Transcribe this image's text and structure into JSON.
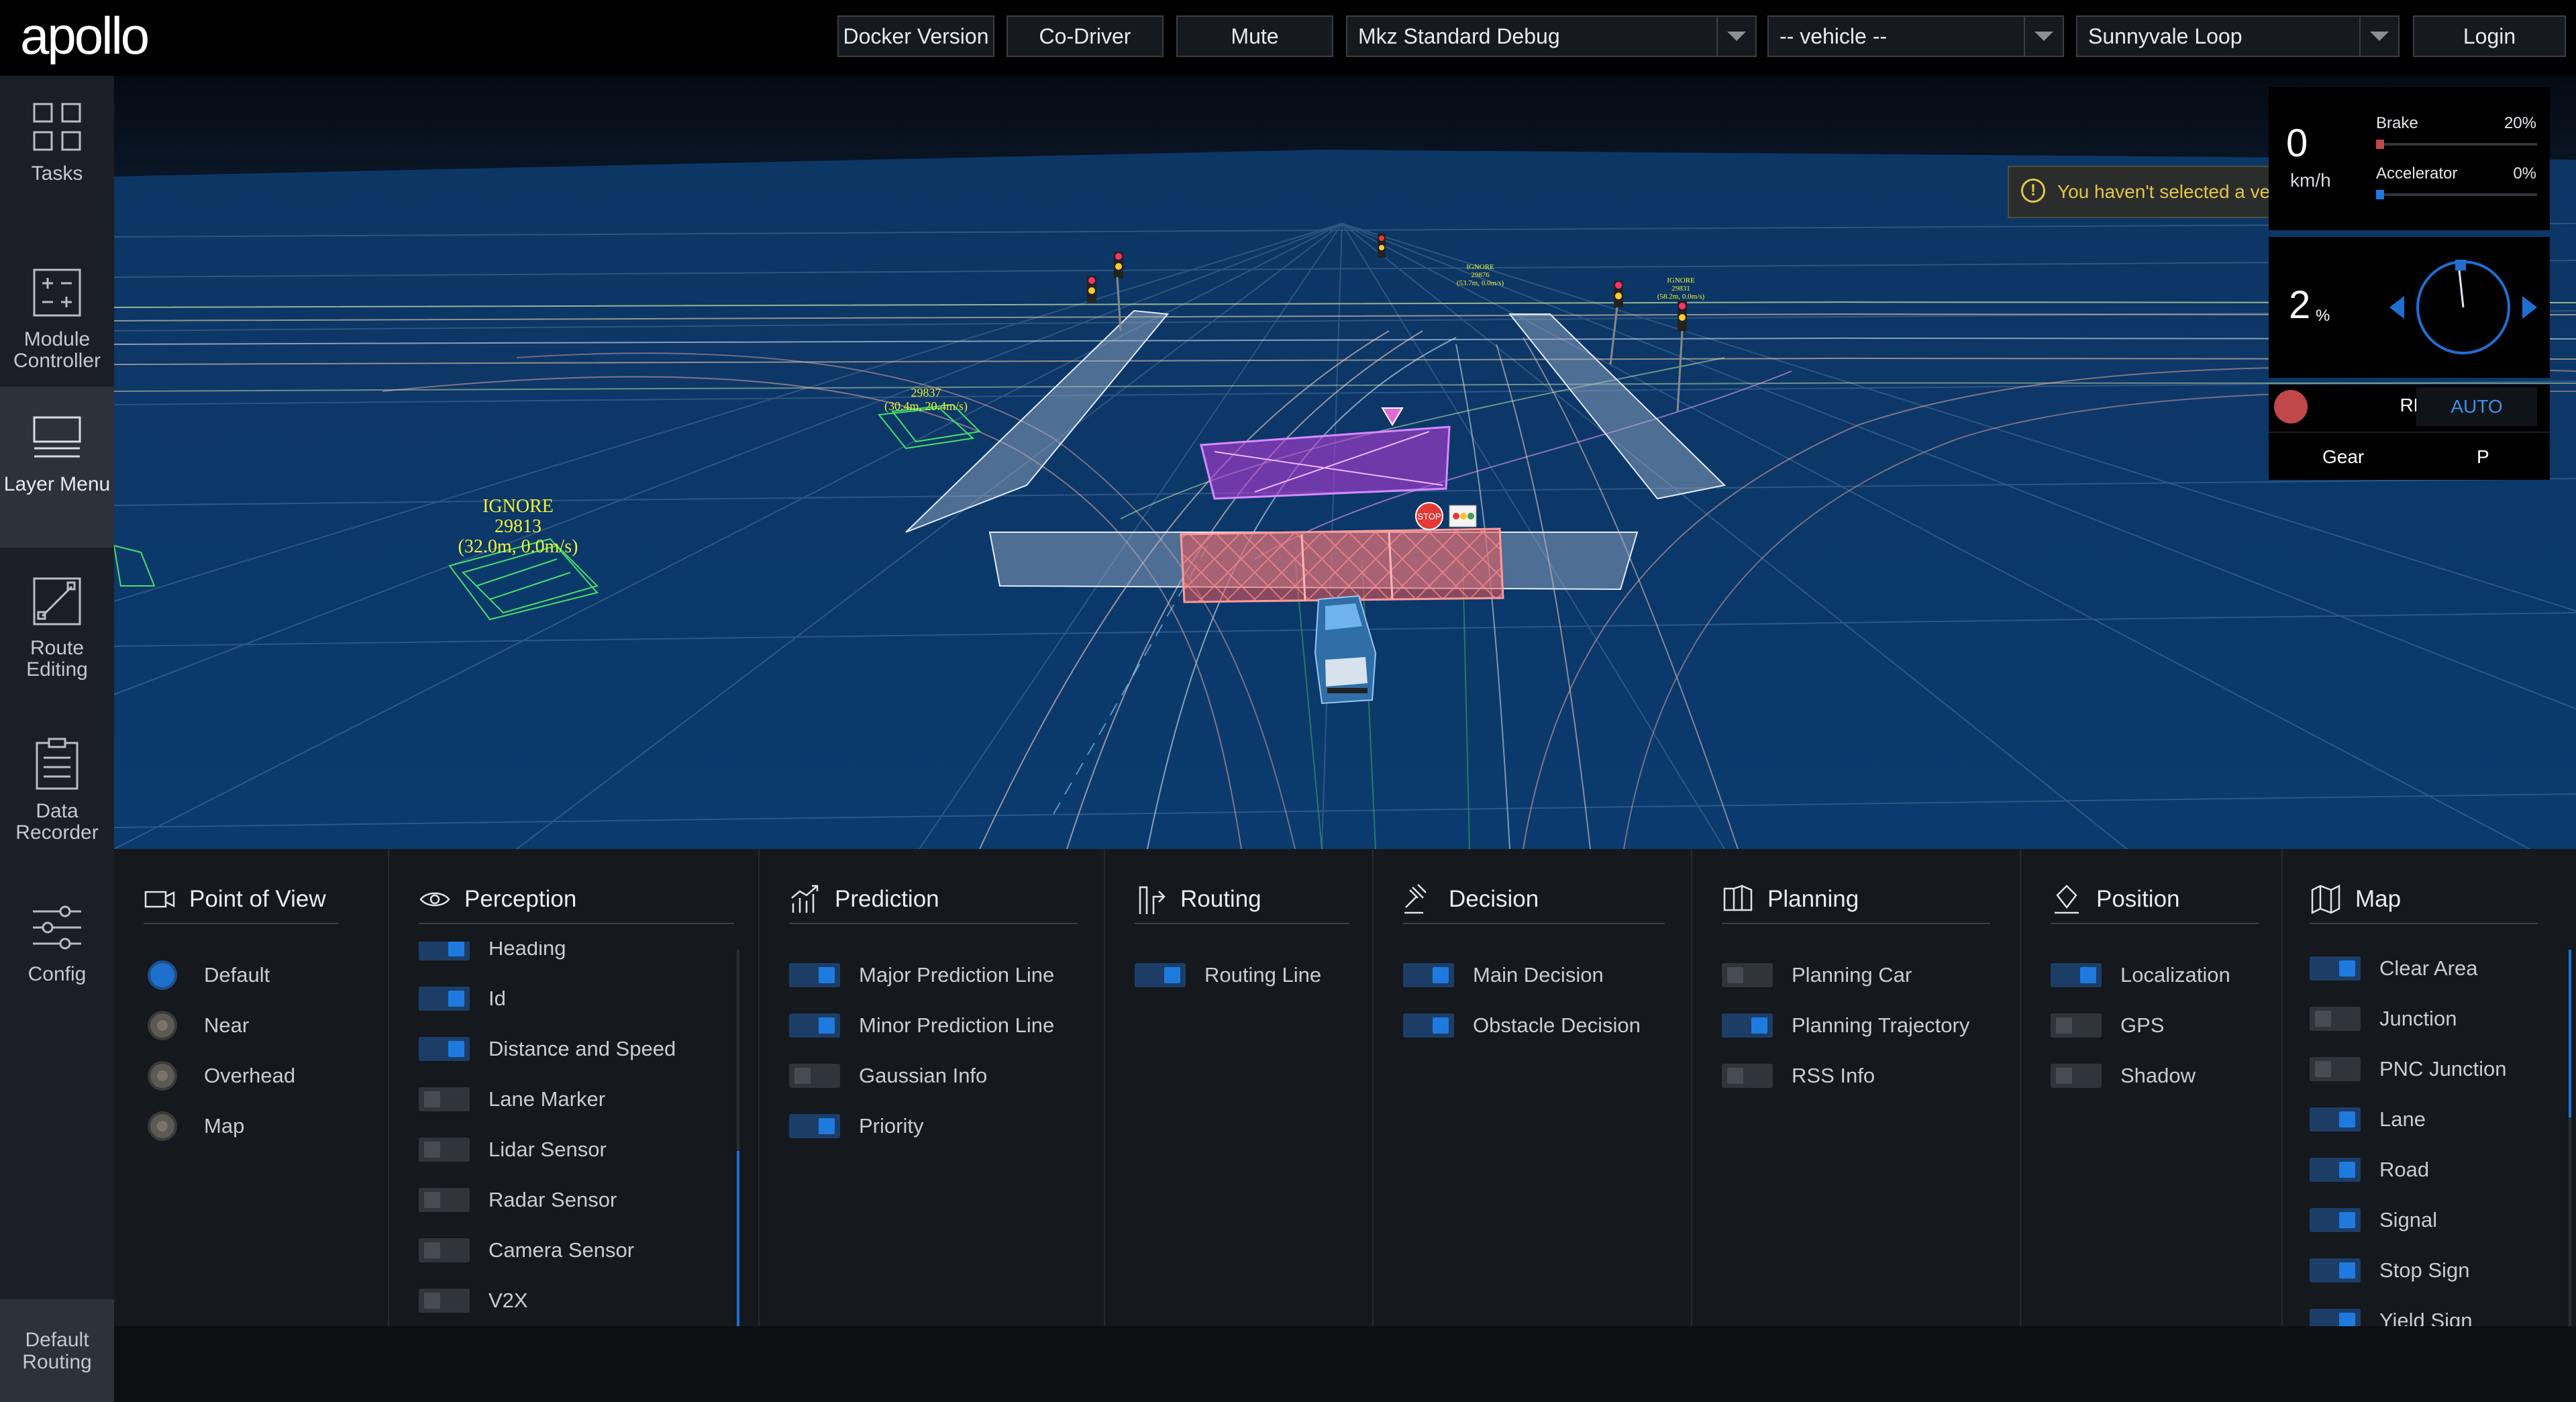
{
  "header": {
    "logo_text": "apollo",
    "docker_version_label": "Docker Version",
    "co_driver_label": "Co-Driver",
    "mute_label": "Mute",
    "mode_select_value": "Mkz Standard Debug",
    "vehicle_select_value": "-- vehicle --",
    "map_select_value": "Sunnyvale Loop",
    "login_label": "Login"
  },
  "sidebar": {
    "items": [
      {
        "label": "Tasks",
        "icon": "tasks-icon"
      },
      {
        "label": "Module Controller",
        "icon": "module-controller-icon"
      },
      {
        "label": "Layer Menu",
        "icon": "layer-menu-icon"
      },
      {
        "label": "Route Editing",
        "icon": "route-editing-icon"
      },
      {
        "label": "Data Recorder",
        "icon": "data-recorder-icon"
      },
      {
        "label": "Config",
        "icon": "config-icon"
      }
    ],
    "active": "Layer Menu",
    "footer_label": "Default Routing"
  },
  "alert": {
    "icon": "warning-icon",
    "text": "You haven't selected a vehicle yet!"
  },
  "scene": {
    "obstacle_labels": [
      {
        "line1": "IGNORE",
        "line2": "29813",
        "line3": "(32.0m, 0.0m/s)"
      },
      {
        "line1": "29837",
        "line2": "(30.4m, 20.4m/s)"
      },
      {
        "line1": "IGNORE",
        "line2": "29876",
        "line3": "(53.7m, 0.0m/s)"
      },
      {
        "line1": "IGNORE",
        "line2": "29831",
        "line3": "(58.2m, 0.0m/s)"
      }
    ],
    "stop_sign_text": "STOP"
  },
  "dashboard": {
    "speed": "0",
    "speed_unit": "km/h",
    "brake_label": "Brake",
    "brake_value": "20%",
    "brake_fraction": 0.2,
    "accelerator_label": "Accelerator",
    "accelerator_value": "0%",
    "accelerator_fraction": 0.0,
    "steering_value": "2",
    "steering_unit": "%",
    "traffic_signal": "RED",
    "drive_mode": "AUTO",
    "gear_label": "Gear",
    "gear_value": "P",
    "colors": {
      "brake": "#c0474a",
      "accelerator": "#1f7adf",
      "signal_red": "#c0474a",
      "auto": "#3f8fe6"
    }
  },
  "layers": {
    "point_of_view": {
      "title": "Point of View",
      "icon": "camera-icon",
      "options": [
        {
          "label": "Default",
          "selected": true
        },
        {
          "label": "Near",
          "selected": false
        },
        {
          "label": "Overhead",
          "selected": false
        },
        {
          "label": "Map",
          "selected": false
        }
      ]
    },
    "perception": {
      "title": "Perception",
      "icon": "eye-icon",
      "options": [
        {
          "label": "Heading",
          "on": true
        },
        {
          "label": "Id",
          "on": true
        },
        {
          "label": "Distance and Speed",
          "on": true
        },
        {
          "label": "Lane Marker",
          "on": false
        },
        {
          "label": "Lidar Sensor",
          "on": false
        },
        {
          "label": "Radar Sensor",
          "on": false
        },
        {
          "label": "Camera Sensor",
          "on": false
        },
        {
          "label": "V2X",
          "on": false
        }
      ]
    },
    "prediction": {
      "title": "Prediction",
      "icon": "chart-icon",
      "options": [
        {
          "label": "Major Prediction Line",
          "on": true
        },
        {
          "label": "Minor Prediction Line",
          "on": true
        },
        {
          "label": "Gaussian Info",
          "on": false
        },
        {
          "label": "Priority",
          "on": true
        }
      ]
    },
    "routing": {
      "title": "Routing",
      "icon": "routing-icon",
      "options": [
        {
          "label": "Routing Line",
          "on": true
        }
      ]
    },
    "decision": {
      "title": "Decision",
      "icon": "gavel-icon",
      "options": [
        {
          "label": "Main Decision",
          "on": true
        },
        {
          "label": "Obstacle Decision",
          "on": true
        }
      ]
    },
    "planning": {
      "title": "Planning",
      "icon": "planning-icon",
      "options": [
        {
          "label": "Planning Car",
          "on": false
        },
        {
          "label": "Planning Trajectory",
          "on": true
        },
        {
          "label": "RSS Info",
          "on": false
        }
      ]
    },
    "position": {
      "title": "Position",
      "icon": "location-icon",
      "options": [
        {
          "label": "Localization",
          "on": true
        },
        {
          "label": "GPS",
          "on": false
        },
        {
          "label": "Shadow",
          "on": false
        }
      ]
    },
    "map": {
      "title": "Map",
      "icon": "map-icon",
      "options": [
        {
          "label": "Clear Area",
          "on": true
        },
        {
          "label": "Junction",
          "on": false
        },
        {
          "label": "PNC Junction",
          "on": false
        },
        {
          "label": "Lane",
          "on": true
        },
        {
          "label": "Road",
          "on": true
        },
        {
          "label": "Signal",
          "on": true
        },
        {
          "label": "Stop Sign",
          "on": true
        },
        {
          "label": "Yield Sign",
          "on": true
        }
      ]
    }
  }
}
